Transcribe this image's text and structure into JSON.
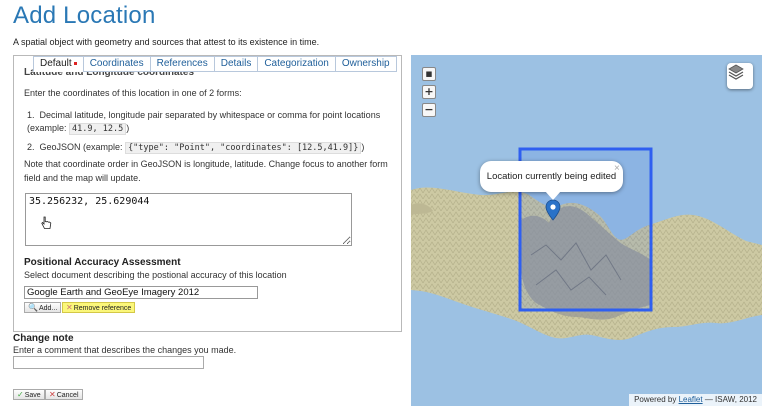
{
  "page": {
    "title": "Add Location",
    "description": "A spatial object with geometry and sources that attest to its existence in time."
  },
  "tabs": [
    {
      "label": "Default",
      "active": true,
      "error": true
    },
    {
      "label": "Coordinates"
    },
    {
      "label": "References"
    },
    {
      "label": "Details"
    },
    {
      "label": "Categorization"
    },
    {
      "label": "Ownership"
    }
  ],
  "coordinates_section": {
    "title": "Latitude and Longitude coordinates",
    "intro": "Enter the coordinates of this location in one of 2 forms:",
    "form1_text": "Decimal latitude, longitude pair separated by whitespace or comma for point locations (example:",
    "form1_example": "41.9, 12.5",
    "form2_text": "GeoJSON (example:",
    "form2_example": "{\"type\": \"Point\", \"coordinates\": [12.5,41.9]}",
    "close_paren": ")",
    "note": "Note that coordinate order in GeoJSON is longitude, latitude. Change focus to another form field and the map will update.",
    "value": "35.256232, 25.629044"
  },
  "accuracy": {
    "title": "Positional Accuracy Assessment",
    "description": "Select document describing the postional accuracy of this location",
    "value": "Google Earth and GeoEye Imagery 2012",
    "add_label": "Add...",
    "remove_label": "Remove reference"
  },
  "change_note": {
    "title": "Change note",
    "description": "Enter a comment that describes the changes you made.",
    "value": ""
  },
  "actions": {
    "save_label": "Save",
    "cancel_label": "Cancel"
  },
  "map": {
    "zoom_controls": [
      "▪",
      "+",
      "−"
    ],
    "popup_text": "Location currently being edited",
    "popup_close": "×",
    "attribution_prefix": "Powered by",
    "attribution_link": "Leaflet",
    "attribution_suffix": "— ISAW, 2012",
    "colors": {
      "sea": "#9cc1e3",
      "land": "#c9c4a0",
      "selection": "#1f5fe8"
    }
  },
  "icons": {
    "zoom_reset": "square-icon",
    "zoom_in": "plus-icon",
    "zoom_out": "minus-icon",
    "layers": "layers-icon",
    "marker": "map-pin-icon",
    "cursor": "hand-cursor-icon",
    "add": "magnifier-icon",
    "remove": "remove-icon"
  }
}
